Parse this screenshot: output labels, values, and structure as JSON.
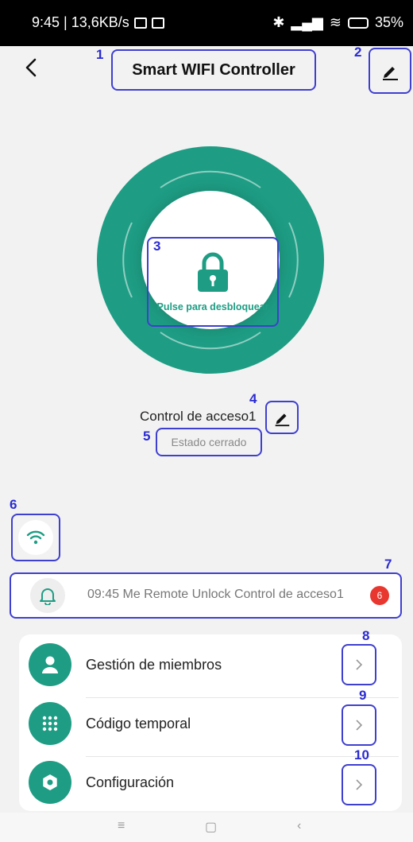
{
  "status_bar": {
    "time_speed": "9:45 | 13,6KB/s",
    "battery": "35%"
  },
  "header": {
    "title": "Smart WIFI Controller"
  },
  "lock": {
    "label": "Pulse para desbloquear"
  },
  "device": {
    "name": "Control de acceso1",
    "state": "Estado cerrado"
  },
  "notification": {
    "text": "09:45 Me  Remote Unlock Control de acceso1",
    "badge": "6"
  },
  "menu": [
    {
      "label": "Gestión de miembros",
      "icon": "member-icon"
    },
    {
      "label": "Código temporal",
      "icon": "keypad-icon"
    },
    {
      "label": "Configuración",
      "icon": "settings-icon"
    }
  ],
  "annotations": [
    "1",
    "2",
    "3",
    "4",
    "5",
    "6",
    "7",
    "8",
    "9",
    "10"
  ],
  "colors": {
    "accent": "#1e9d84",
    "highlight_box": "#3f3fd0",
    "badge": "#e8372f"
  },
  "system_nav": {
    "menu": "≡",
    "home": "▢",
    "back": "‹"
  }
}
